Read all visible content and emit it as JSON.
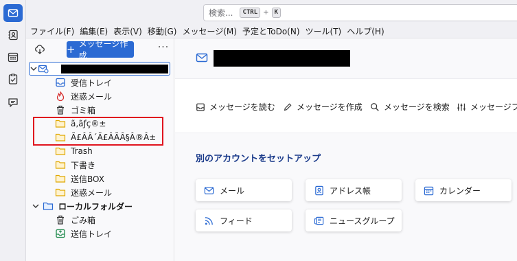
{
  "search": {
    "placeholder": "検索...",
    "key1": "CTRL",
    "plus": "+",
    "key2": "K"
  },
  "menubar": [
    "ファイル(F)",
    "編集(E)",
    "表示(V)",
    "移動(G)",
    "メッセージ(M)",
    "予定とToDo(N)",
    "ツール(T)",
    "ヘルプ(H)"
  ],
  "folderpane": {
    "compose_label": "メッセージ作成",
    "more_label": "···",
    "folders": [
      "受信トレイ",
      "迷惑メール",
      "ゴミ箱",
      "ã‚ãƒç®±",
      "Ã£ÂÂ´Ã£ÂÃÂ§Â®Â±",
      "Trash",
      "下書き",
      "送信BOX",
      "迷惑メール"
    ],
    "local_label": "ローカルフォルダー",
    "local_folders": [
      "ごみ箱",
      "送信トレイ"
    ]
  },
  "actions": {
    "read": "メッセージを読む",
    "compose": "メッセージを作成",
    "search": "メッセージを検索",
    "filter": "メッセージフィル"
  },
  "setup": {
    "title": "別のアカウントをセットアップ",
    "mail": "メール",
    "address_book": "アドレス帳",
    "calendar": "カレンダー",
    "feed": "フィード",
    "newsgroup": "ニュースグループ"
  },
  "colors": {
    "accent": "#2b6ad3",
    "highlight_box": "#e0141e",
    "folder_yellow": "#f5c842"
  }
}
